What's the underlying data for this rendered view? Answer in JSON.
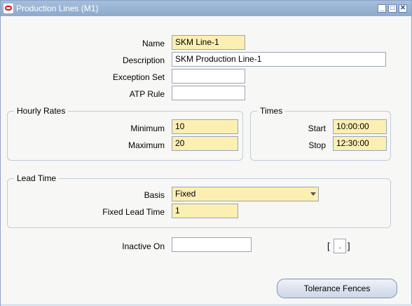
{
  "window": {
    "title": "Production Lines (M1)",
    "controls": [
      "minimize-icon",
      "maximize-icon",
      "close-icon"
    ]
  },
  "fields": {
    "name": {
      "label": "Name",
      "value": "SKM Line-1"
    },
    "description": {
      "label": "Description",
      "value": "SKM Production Line-1"
    },
    "exception_set": {
      "label": "Exception Set",
      "value": ""
    },
    "atp_rule": {
      "label": "ATP Rule",
      "value": ""
    }
  },
  "hourly_rates": {
    "title": "Hourly Rates",
    "minimum": {
      "label": "Minimum",
      "value": "10"
    },
    "maximum": {
      "label": "Maximum",
      "value": "20"
    }
  },
  "times": {
    "title": "Times",
    "start": {
      "label": "Start",
      "value": "10:00:00"
    },
    "stop": {
      "label": "Stop",
      "value": "12:30:00"
    }
  },
  "lead_time": {
    "title": "Lead Time",
    "basis": {
      "label": "Basis",
      "value": "Fixed"
    },
    "fixed_lead_time": {
      "label": "Fixed Lead Time",
      "value": "1"
    }
  },
  "inactive_on": {
    "label": "Inactive On",
    "value": ""
  },
  "flexfield": {
    "open": "[",
    "inner": ".",
    "close": "]"
  },
  "buttons": {
    "tolerance_fences": "Tolerance Fences"
  },
  "colors": {
    "required_field": "#fbefb2",
    "titlebar": "#98b1d3"
  }
}
